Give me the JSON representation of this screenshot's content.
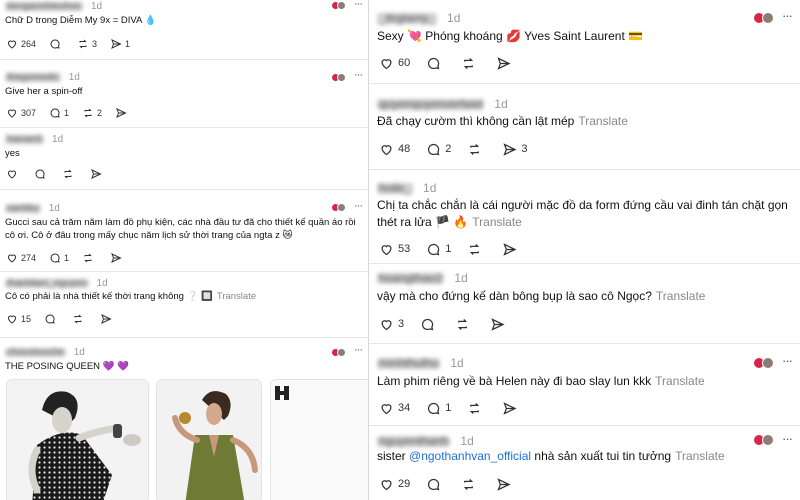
{
  "left_posts": [
    {
      "user": "tiengannhieuhon",
      "time": "1d",
      "text": "Chữ D trong Diễm My 9x = DIVA 💧",
      "likes": "264",
      "comments": "",
      "reposts": "3",
      "shares": "1"
    },
    {
      "user": "thegomedic",
      "time": "1d",
      "text": "Give her a spin-off",
      "likes": "307",
      "comments": "1",
      "reposts": "2",
      "shares": ""
    },
    {
      "user": "haivan5",
      "time": "1d",
      "text": "yes",
      "likes": "",
      "comments": "",
      "reposts": "",
      "shares": ""
    },
    {
      "user": "xanhky",
      "time": "1d",
      "text": "Gucci sau cả trăm năm làm đồ phụ kiện, các nhà đầu tư đã cho thiết kế quần áo rồi cô ơi. Cô ở đâu trong mấy chục năm lịch sử thời trang của ngta z 😿",
      "likes": "274",
      "comments": "1",
      "reposts": "",
      "shares": ""
    },
    {
      "user": "thanhlam_nguyen",
      "time": "1d",
      "text": "Cô có phải là nhà thiết kế thời trang không ❔ 🔲",
      "translate": "Translate",
      "likes": "15",
      "comments": "",
      "reposts": "",
      "shares": ""
    },
    {
      "user": "chocotouche",
      "time": "1d",
      "text": "THE POSING QUEEN 💜 💜"
    }
  ],
  "right_posts": [
    {
      "user": "_ttrglamy_",
      "time": "1d",
      "text": "Sexy 💘 Phóng khoáng 💋 Yves Saint Laurent 💳",
      "likes": "60",
      "comments": "",
      "reposts": "",
      "shares": ""
    },
    {
      "user": "quyenquyenvertwel",
      "time": "1d",
      "text": "Đã chạy cườm thì không cần lật mép",
      "translate": "Translate",
      "likes": "48",
      "comments": "2",
      "reposts": "",
      "shares": "3"
    },
    {
      "user": "hoile_",
      "time": "1d",
      "text": "Chị ta chắc chắn là cái người mặc đồ da form đứng cầu vai đinh tán chặt gọn thét ra lửa 🏴 🔥",
      "translate": "Translate",
      "likes": "53",
      "comments": "1",
      "reposts": "",
      "shares": ""
    },
    {
      "user": "hoangthao2",
      "time": "1d",
      "text": "vậy mà cho đứng kế dàn bông bụp là sao cô Ngọc?",
      "translate": "Translate",
      "likes": "3",
      "comments": "",
      "reposts": "",
      "shares": ""
    },
    {
      "user": "minhthuthu",
      "time": "1d",
      "text": "Làm phim riêng về bà Helen này đi bao slay lun kkk",
      "translate": "Translate",
      "likes": "34",
      "comments": "1",
      "reposts": "",
      "shares": ""
    },
    {
      "user": "nguyenthanh",
      "time": "1d",
      "text_prefix": "sister",
      "mention": "@ngothanhvan_official",
      "text_suffix": "nhà sản xuất tui tin tưởng",
      "translate": "Translate",
      "likes": "29",
      "comments": "",
      "reposts": "",
      "shares": ""
    }
  ],
  "colors": {
    "mention": "#1f6fd6",
    "translate": "#8a8a8a",
    "like_avatar": "#d7264a"
  },
  "icons": [
    "heart-icon",
    "comment-icon",
    "repost-icon",
    "share-icon",
    "more-icon"
  ]
}
